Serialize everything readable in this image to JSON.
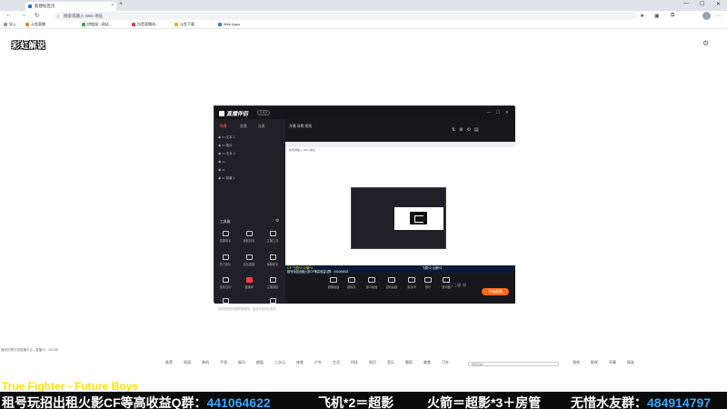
{
  "browser": {
    "tab_title": "新建标签页",
    "tab_close": "×",
    "new_tab": "+",
    "window_controls": [
      "—",
      "☐",
      "✕"
    ],
    "nav": {
      "back": "←",
      "forward": "→",
      "refresh": "↻"
    },
    "address_placeholder": "搜索或输入 Web 地址",
    "bookmarks": [
      "导入",
      "斗鱼直播",
      "拼链接 - 网站...",
      "抖音直播间...",
      "斗鱼下载",
      "Web Apps"
    ],
    "avatar_initial": ""
  },
  "stream_name": "彩虹解说",
  "app": {
    "logo": "直播伴侣",
    "badge": "2.4.2",
    "window_controls": [
      "—",
      "☐",
      "✕"
    ],
    "left_tabs": [
      "场景",
      "直播",
      "连麦"
    ],
    "scenes": [
      "文本 1",
      "图片",
      "文本 2",
      "",
      "",
      "背景 1"
    ],
    "tools_label": "工具箱",
    "tools": [
      {
        "label": "录屏助手",
        "highlight": false
      },
      {
        "label": "美颜特效",
        "highlight": false
      },
      {
        "label": "主播工具",
        "highlight": false
      },
      {
        "label": "热门音乐",
        "highlight": false
      },
      {
        "label": "高清直播",
        "highlight": false
      },
      {
        "label": "弹幕助手",
        "highlight": false
      },
      {
        "label": "连线互动",
        "highlight": false
      },
      {
        "label": "直播间",
        "highlight": true
      },
      {
        "label": "主播课堂",
        "highlight": false
      },
      {
        "label": "PK",
        "highlight": false
      },
      {
        "label": "",
        "highlight": false
      },
      {
        "label": "更多",
        "highlight": false
      }
    ],
    "warning": "检测到您的电脑配置偏低，建议开启优化模式",
    "main_top": "开播  场景  视频",
    "preview_addr": "搜索或输入 Web 地址",
    "ticker_left": "CF 飞机*2 火箭*3",
    "ticker_mid": "租号玩招出租火影CF等高收益Q群：441064622",
    "ticker_right": "飞机*2  火箭*3",
    "controls": [
      "直播画面",
      "摄像头",
      "窗口画面",
      "游戏画面",
      "麦克风",
      "音乐",
      "提词器"
    ],
    "live_button": "开始直播"
  },
  "status_line": "播放的是在线直播平台 - 直播中：2024年",
  "strip": {
    "labels": [
      "推荐",
      "网游",
      "单机",
      "手游",
      "娱乐",
      "颜值",
      "二次元",
      "体育",
      "户外",
      "生活",
      "科技",
      "知识",
      "音乐",
      "舞蹈",
      "美食",
      "汽车",
      "游戏",
      "影视",
      "军事",
      "搞笑"
    ],
    "search_placeholder": "搜索直播"
  },
  "scroller": "True Fighter - Future Boys",
  "banner": {
    "left_text": "租号玩招出租火影CF等高收益Q群：",
    "left_num": "441064622",
    "mid1": "飞机*2＝超影",
    "mid2": "火箭＝超影*3＋房管",
    "right_text": "无惜水友群：",
    "right_num": "484914797"
  }
}
